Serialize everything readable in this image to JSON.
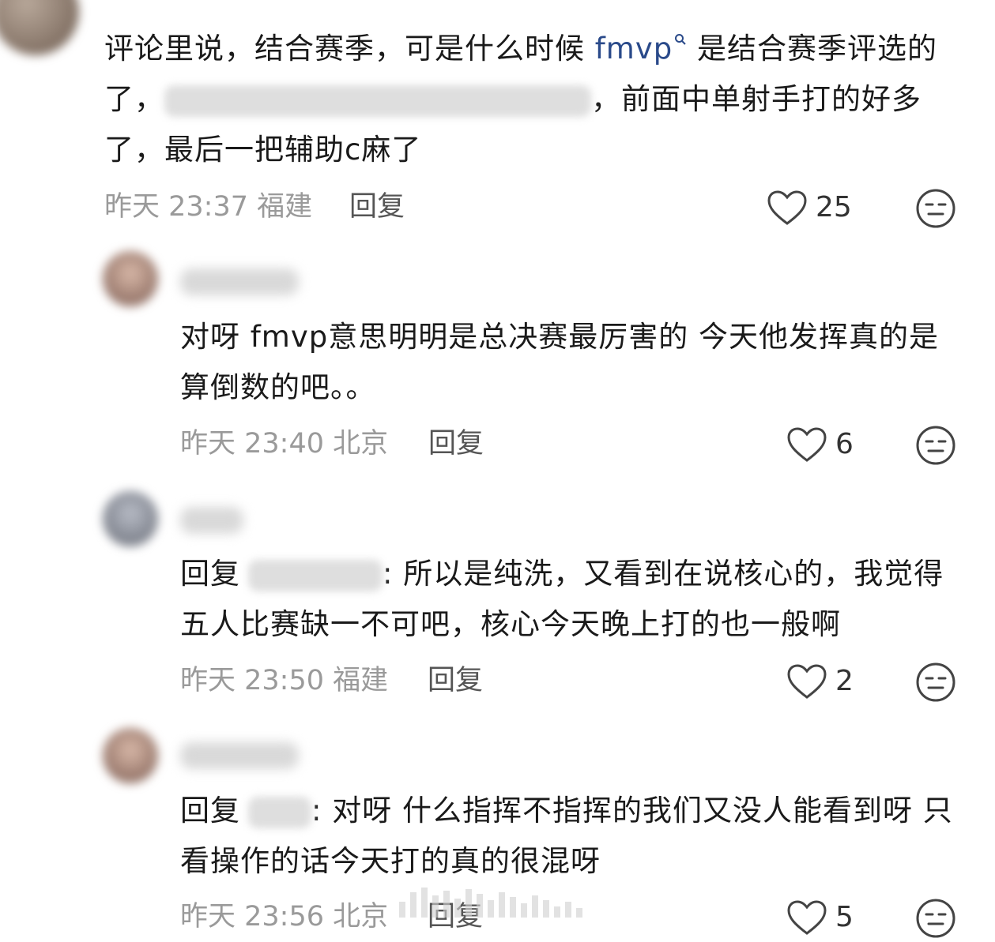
{
  "comments": [
    {
      "text_prefix": "评论里说，结合赛季，可是什么时候 ",
      "link": "fmvp",
      "text_mid": " 是结合赛季评选的了，",
      "text_suffix": "，前面中单射手打的好多了，最后一把辅助c麻了",
      "meta": "昨天 23:37 福建",
      "reply_label": "回复",
      "likes": "25"
    },
    {
      "text": "对呀 fmvp意思明明是总决赛最厉害的 今天他发挥真的是算倒数的吧。。",
      "meta": "昨天 23:40 北京",
      "reply_label": "回复",
      "likes": "6"
    },
    {
      "reply_prefix": "回复",
      "text": ": 所以是纯洗，又看到在说核心的，我觉得五人比赛缺一不可吧，核心今天晚上打的也一般啊",
      "meta": "昨天 23:50 福建",
      "reply_label": "回复",
      "likes": "2"
    },
    {
      "reply_prefix": "回复",
      "text": ": 对呀 什么指挥不指挥的我们又没人能看到呀 只看操作的话今天打的真的很混呀",
      "meta": "昨天 23:56 北京",
      "reply_label": "回复",
      "likes": "5"
    }
  ],
  "icons": {
    "like": "heart-outline-icon",
    "dislike": "neutral-face-icon",
    "search": "search-icon"
  }
}
